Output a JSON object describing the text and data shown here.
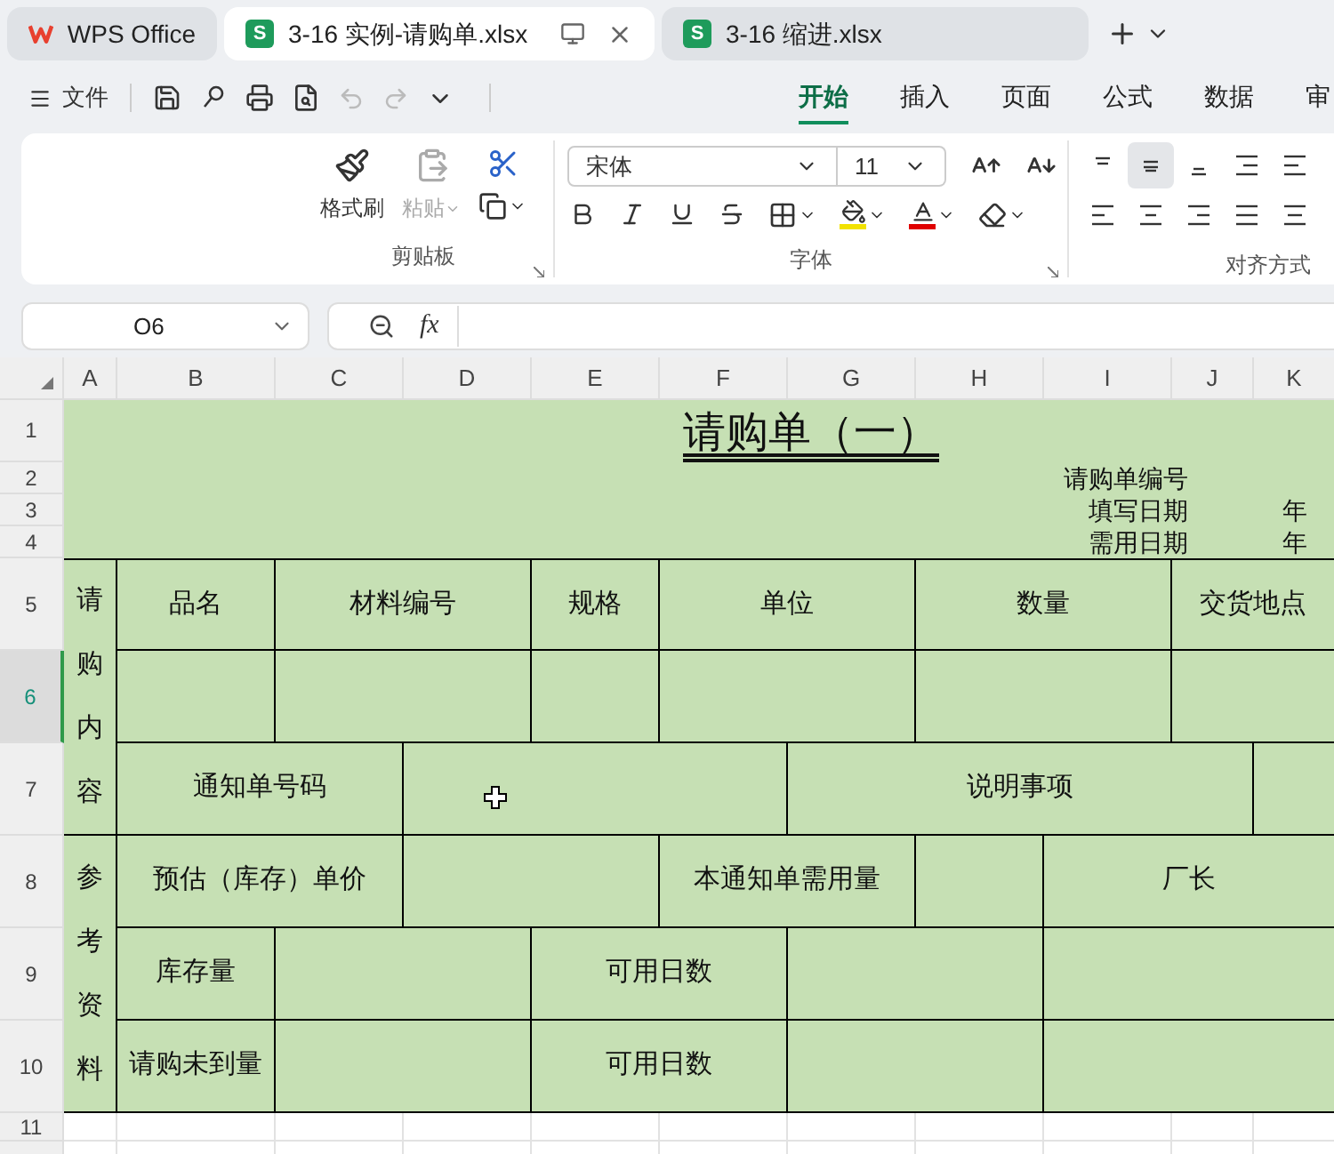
{
  "tabs": [
    {
      "label": "WPS Office",
      "kind": "home",
      "selected": false
    },
    {
      "label": "3-16 实例-请购单.xlsx",
      "kind": "sheet",
      "badge": "S",
      "selected": true
    },
    {
      "label": "3-16 缩进.xlsx",
      "kind": "sheet",
      "badge": "S",
      "selected": false
    }
  ],
  "quick_bar": {
    "file_menu": "文件"
  },
  "ribbon_tabs": [
    {
      "label": "开始",
      "selected": true
    },
    {
      "label": "插入",
      "selected": false
    },
    {
      "label": "页面",
      "selected": false
    },
    {
      "label": "公式",
      "selected": false
    },
    {
      "label": "数据",
      "selected": false
    },
    {
      "label": "审",
      "selected": false
    }
  ],
  "ribbon": {
    "clipboard": {
      "title": "剪贴板",
      "format_painter": "格式刷",
      "paste": {
        "label": "粘贴",
        "disabled": true
      }
    },
    "font": {
      "title": "字体",
      "font_name": "宋体",
      "font_size": "11"
    },
    "alignment": {
      "title": "对齐方式"
    }
  },
  "formula_bar": {
    "name_box": "O6",
    "function_label": "fx"
  },
  "sheet": {
    "columns": [
      "A",
      "B",
      "C",
      "D",
      "E",
      "F",
      "G",
      "H",
      "I",
      "J",
      "K"
    ],
    "rows": [
      {
        "label": "1",
        "selected": false
      },
      {
        "label": "2",
        "selected": false
      },
      {
        "label": "3",
        "selected": false
      },
      {
        "label": "4",
        "selected": false
      },
      {
        "label": "5",
        "selected": false
      },
      {
        "label": "6",
        "selected": true
      },
      {
        "label": "7",
        "selected": false
      },
      {
        "label": "8",
        "selected": false
      },
      {
        "label": "9",
        "selected": false
      },
      {
        "label": "10",
        "selected": false
      },
      {
        "label": "11",
        "selected": false
      }
    ],
    "cells": [
      "请购单（一）",
      "请购单编号",
      "填写日期",
      "年",
      "需用日期",
      "年",
      "请购内容",
      "品名",
      "材料编号",
      "规格",
      "单位",
      "数量",
      "交货地点",
      "通知单号码",
      "说明事项",
      "参考资料",
      "预估（库存）单价",
      "本通知单需用量",
      "厂长",
      "库存量",
      "可用日数",
      "请购未到量",
      "可用日数"
    ]
  }
}
